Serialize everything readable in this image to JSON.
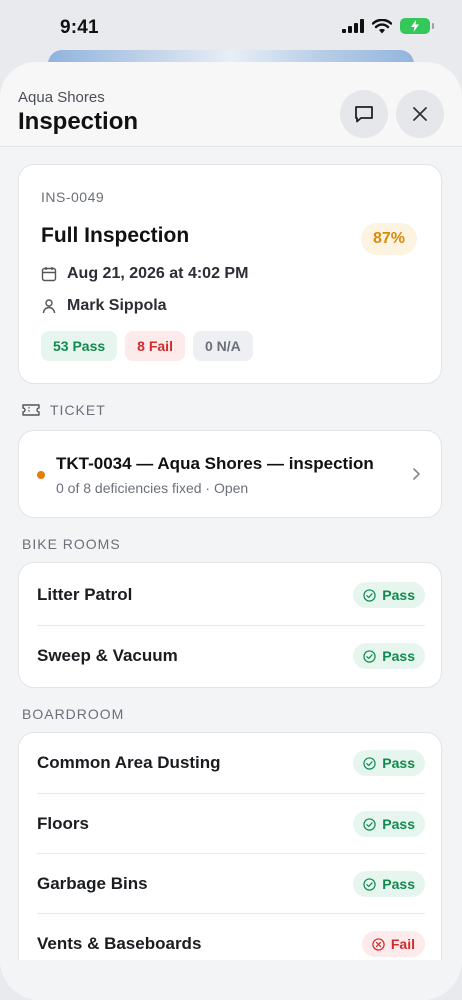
{
  "status_bar": {
    "time": "9:41"
  },
  "header": {
    "subtitle": "Aqua Shores",
    "title": "Inspection"
  },
  "summary": {
    "id": "INS-0049",
    "title": "Full Inspection",
    "score": "87%",
    "date": "Aug 21, 2026 at 4:02 PM",
    "inspector": "Mark Sippola",
    "chips": {
      "pass": "53 Pass",
      "fail": "8 Fail",
      "na": "0 N/A"
    }
  },
  "ticket_section": {
    "label": "TICKET",
    "title": "TKT-0034 — Aqua Shores — inspection",
    "subtitle": "0 of 8 deficiencies fixed · Open"
  },
  "sections": [
    {
      "label": "BIKE ROOMS",
      "rows": [
        {
          "label": "Litter Patrol",
          "status": "Pass"
        },
        {
          "label": "Sweep & Vacuum",
          "status": "Pass"
        }
      ]
    },
    {
      "label": "BOARDROOM",
      "rows": [
        {
          "label": "Common Area Dusting",
          "status": "Pass"
        },
        {
          "label": "Floors",
          "status": "Pass"
        },
        {
          "label": "Garbage Bins",
          "status": "Pass"
        },
        {
          "label": "Vents & Baseboards",
          "status": "Fail"
        }
      ]
    }
  ],
  "colors": {
    "pass": "#128a4f",
    "pass_bg": "#e6f6ee",
    "fail": "#d12c2c",
    "fail_bg": "#fdeaea",
    "score": "#d98a0b",
    "score_bg": "#fdf3e1",
    "ticket_dot": "#e57d0c"
  },
  "icons": {
    "header": [
      "chat-icon",
      "close-icon"
    ],
    "meta": [
      "calendar-icon",
      "person-icon"
    ],
    "ticket": [
      "ticket-icon",
      "chevron-right-icon"
    ],
    "status": [
      "check-circle-icon",
      "x-circle-icon"
    ]
  }
}
